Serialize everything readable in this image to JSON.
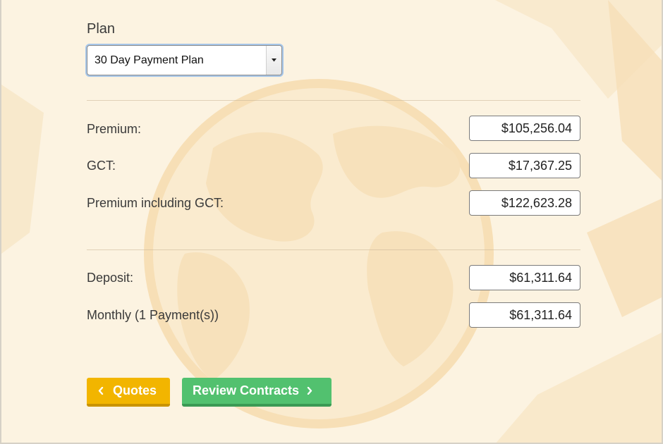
{
  "plan": {
    "label": "Plan",
    "selected": "30 Day Payment Plan"
  },
  "premium_section": {
    "rows": [
      {
        "label": "Premium:",
        "value": "$105,256.04"
      },
      {
        "label": "GCT:",
        "value": "$17,367.25"
      },
      {
        "label": "Premium including GCT:",
        "value": "$122,623.28"
      }
    ]
  },
  "payment_section": {
    "rows": [
      {
        "label": "Deposit:",
        "value": "$61,311.64"
      },
      {
        "label": "Monthly (1 Payment(s))",
        "value": "$61,311.64"
      }
    ]
  },
  "actions": {
    "back_label": "Quotes",
    "next_label": "Review Contracts",
    "back_color": "#f2b500",
    "next_color": "#52c16f"
  },
  "icons": {
    "back": "chevron-left-icon",
    "next": "chevron-right-icon",
    "dropdown": "caret-down-icon",
    "background": "globe-icon"
  }
}
